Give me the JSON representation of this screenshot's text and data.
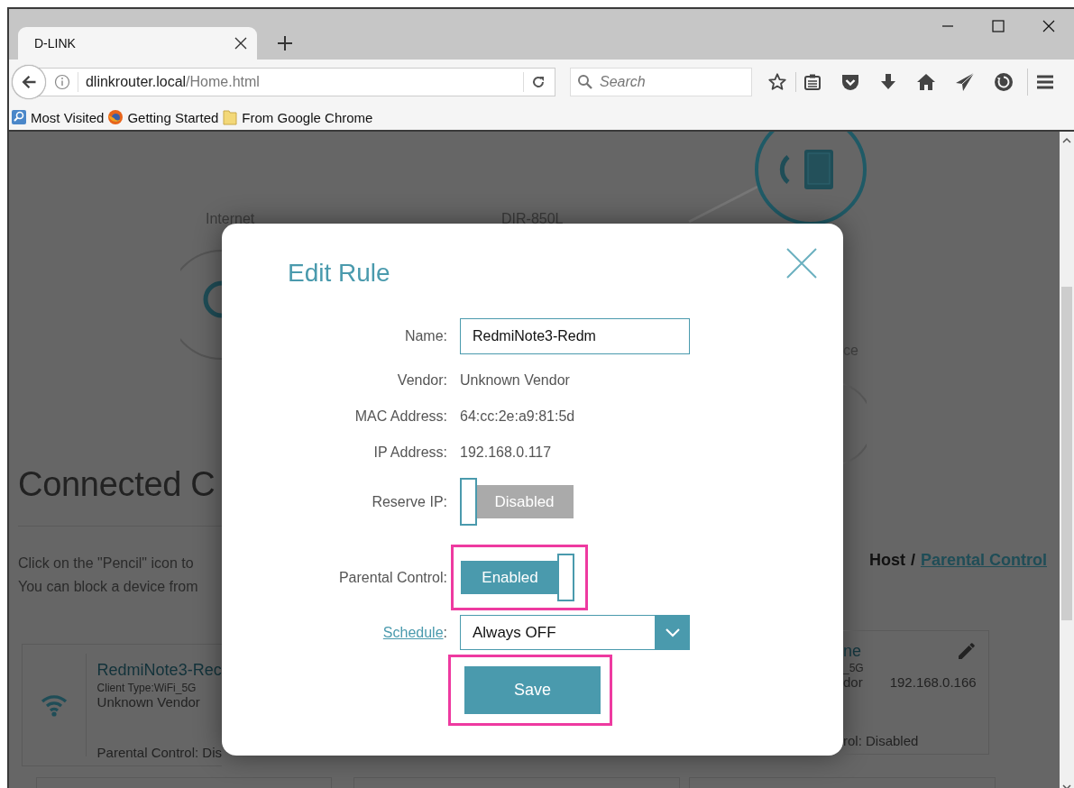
{
  "browser": {
    "tab": {
      "title": "D-LINK"
    },
    "address": {
      "host": "dlinkrouter.local",
      "path": "/Home.html"
    },
    "search": {
      "placeholder": "Search"
    },
    "bookmarks": [
      {
        "label": "Most Visited",
        "kind": "smart"
      },
      {
        "label": "Getting Started",
        "kind": "firefox"
      },
      {
        "label": "From Google Chrome",
        "kind": "folder"
      }
    ]
  },
  "page": {
    "diagram": {
      "internet_label": "Internet",
      "router_label": "DIR-850L",
      "client_label": "ce"
    },
    "heading": "Connected C",
    "intro": [
      "Click on the \"Pencil\" icon to",
      "You can block a device from"
    ],
    "breadcrumb": {
      "current": "Host",
      "separator": "/",
      "link": "Parental Control"
    },
    "cards": [
      {
        "name": "RedmiNote3-Rec",
        "client_type": "Client Type:WiFi_5G",
        "vendor": "Unknown Vendor",
        "parental": "Parental Control: Dis"
      },
      {
        "name": "ne",
        "client_type": "_5G",
        "vendor": "dor",
        "ip": "192.168.0.166",
        "parental": "rol: Disabled"
      }
    ]
  },
  "dialog": {
    "title": "Edit Rule",
    "fields": [
      {
        "kind": "input",
        "label": "Name:",
        "value": "RedmiNote3-Redm"
      },
      {
        "kind": "text",
        "label": "Vendor:",
        "value": "Unknown Vendor"
      },
      {
        "kind": "text",
        "label": "MAC Address:",
        "value": "64:cc:2e:a9:81:5d"
      },
      {
        "kind": "text",
        "label": "IP Address:",
        "value": "192.168.0.117"
      },
      {
        "kind": "toggle",
        "label": "Reserve IP:",
        "value": "Disabled",
        "on": false,
        "highlighted": false
      },
      {
        "kind": "toggle",
        "label": "Parental Control:",
        "value": "Enabled",
        "on": true,
        "highlighted": true
      },
      {
        "kind": "select",
        "link": "Schedule",
        "label": ":",
        "value": "Always OFF"
      }
    ],
    "save": {
      "label": "Save",
      "highlighted": true
    }
  }
}
